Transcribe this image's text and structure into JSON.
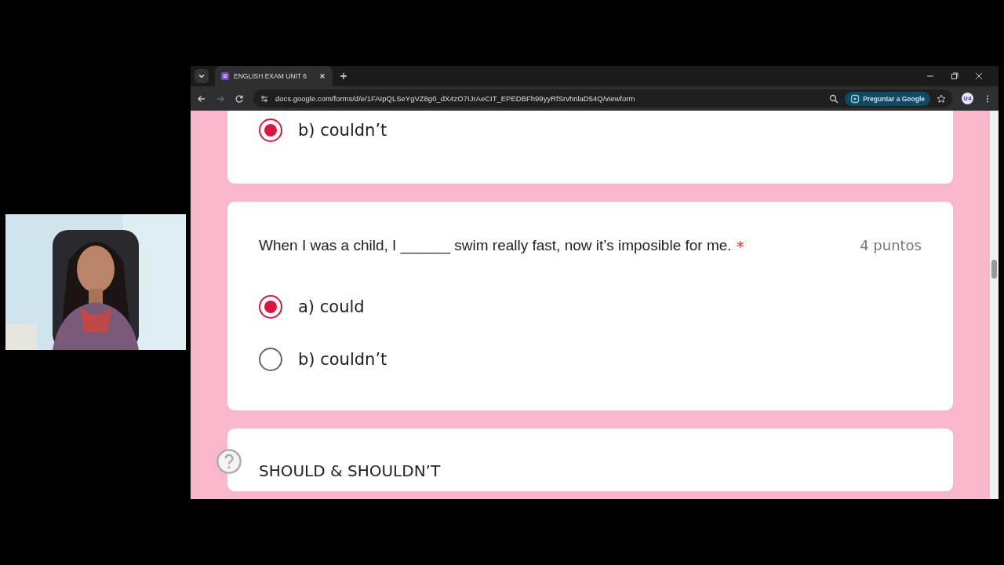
{
  "browser": {
    "tab_title": "ENGLISH EXAM UNIT 6",
    "address": "docs.google.com/forms/d/e/1FAIpQLSeYgVZ8g0_dX4zO7IJrAeCIT_EPEDBFh99yyRfSrvhnlaD54Q/viewform",
    "ask_button": "Preguntar a Google",
    "profile": "U4"
  },
  "previous_question": {
    "options": [
      {
        "label": "b) couldn’t",
        "selected": true
      }
    ]
  },
  "question": {
    "text": "When I was a child, I ______ swim really fast, now it’s imposible for me.",
    "required_mark": "*",
    "points": "4 puntos",
    "options": [
      {
        "label": "a) could",
        "selected": true
      },
      {
        "label": "b) couldn’t",
        "selected": false
      }
    ]
  },
  "next_section": {
    "title": "SHOULD & SHOULDN’T"
  }
}
